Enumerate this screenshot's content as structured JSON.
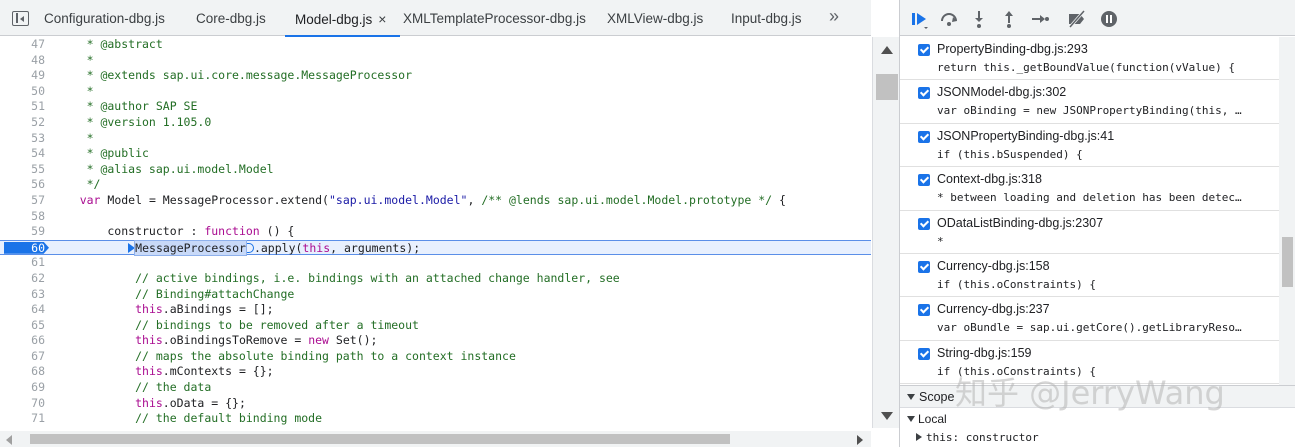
{
  "editor": {
    "tabs": [
      {
        "label": "Configuration-dbg.js"
      },
      {
        "label": "Core-dbg.js"
      },
      {
        "label": "Model-dbg.js",
        "active": true
      },
      {
        "label": "XMLTemplateProcessor-dbg.js"
      },
      {
        "label": "XMLView-dbg.js"
      },
      {
        "label": "Input-dbg.js"
      }
    ],
    "close_glyph": "×",
    "more_glyph": "»",
    "current_line": 60,
    "code_lines": [
      {
        "n": "47",
        "text": "     * @abstract"
      },
      {
        "n": "48",
        "text": "     *"
      },
      {
        "n": "49",
        "text": "     * @extends sap.ui.core.message.MessageProcessor"
      },
      {
        "n": "50",
        "text": "     *"
      },
      {
        "n": "51",
        "text": "     * @author SAP SE"
      },
      {
        "n": "52",
        "text": "     * @version 1.105.0"
      },
      {
        "n": "53",
        "text": "     *"
      },
      {
        "n": "54",
        "text": "     * @public"
      },
      {
        "n": "55",
        "text": "     * @alias sap.ui.model.Model"
      },
      {
        "n": "56",
        "text": "     */"
      },
      {
        "n": "57",
        "text": "    var Model = MessageProcessor.extend(\"sap.ui.model.Model\", /** @lends sap.ui.model.Model.prototype */ {"
      },
      {
        "n": "58",
        "text": ""
      },
      {
        "n": "59",
        "text": "        constructor : function () {"
      },
      {
        "n": "60",
        "text": "            MessageProcessor.apply(this, arguments);"
      },
      {
        "n": "61",
        "text": ""
      },
      {
        "n": "62",
        "text": "            // active bindings, i.e. bindings with an attached change handler, see"
      },
      {
        "n": "63",
        "text": "            // Binding#attachChange"
      },
      {
        "n": "64",
        "text": "            this.aBindings = [];"
      },
      {
        "n": "65",
        "text": "            // bindings to be removed after a timeout"
      },
      {
        "n": "66",
        "text": "            this.oBindingsToRemove = new Set();"
      },
      {
        "n": "67",
        "text": "            // maps the absolute binding path to a context instance"
      },
      {
        "n": "68",
        "text": "            this.mContexts = {};"
      },
      {
        "n": "69",
        "text": "            // the data"
      },
      {
        "n": "70",
        "text": "            this.oData = {};"
      },
      {
        "n": "71",
        "text": "            // the default binding mode"
      }
    ]
  },
  "debugger": {
    "toolbar": [
      {
        "name": "resume-button",
        "icon": "resume-icon"
      },
      {
        "name": "step-over-button",
        "icon": "step-over-icon"
      },
      {
        "name": "step-into-button",
        "icon": "step-into-icon"
      },
      {
        "name": "step-out-button",
        "icon": "step-out-icon"
      },
      {
        "name": "step-button",
        "icon": "step-icon"
      },
      {
        "name": "deactivate-breakpoints-button",
        "icon": "deactivate-breakpoints-icon"
      },
      {
        "name": "pause-on-exceptions-button",
        "icon": "pause-icon"
      }
    ],
    "call_stack": [
      {
        "file": "PropertyBinding-dbg.js:293",
        "code": "return this._getBoundValue(function(vValue) {"
      },
      {
        "file": "JSONModel-dbg.js:302",
        "code": "var oBinding = new JSONPropertyBinding(this, …"
      },
      {
        "file": "JSONPropertyBinding-dbg.js:41",
        "code": "if (this.bSuspended) {"
      },
      {
        "file": "Context-dbg.js:318",
        "code": "* between loading and deletion has been detec…"
      },
      {
        "file": "ODataListBinding-dbg.js:2307",
        "code": "*"
      },
      {
        "file": "Currency-dbg.js:158",
        "code": "if (this.oConstraints) {"
      },
      {
        "file": "Currency-dbg.js:237",
        "code": "var oBundle = sap.ui.getCore().getLibraryReso…"
      },
      {
        "file": "String-dbg.js:159",
        "code": "if (this.oConstraints) {"
      }
    ],
    "scope": {
      "title": "Scope",
      "local_label": "Local",
      "this_value": "this: constructor"
    }
  },
  "watermark": "知乎 @JerryWang",
  "colors": {
    "accent": "#1a73e8",
    "comment": "#236e25",
    "keyword": "#aa0d91",
    "string": "#1a1aa6"
  }
}
